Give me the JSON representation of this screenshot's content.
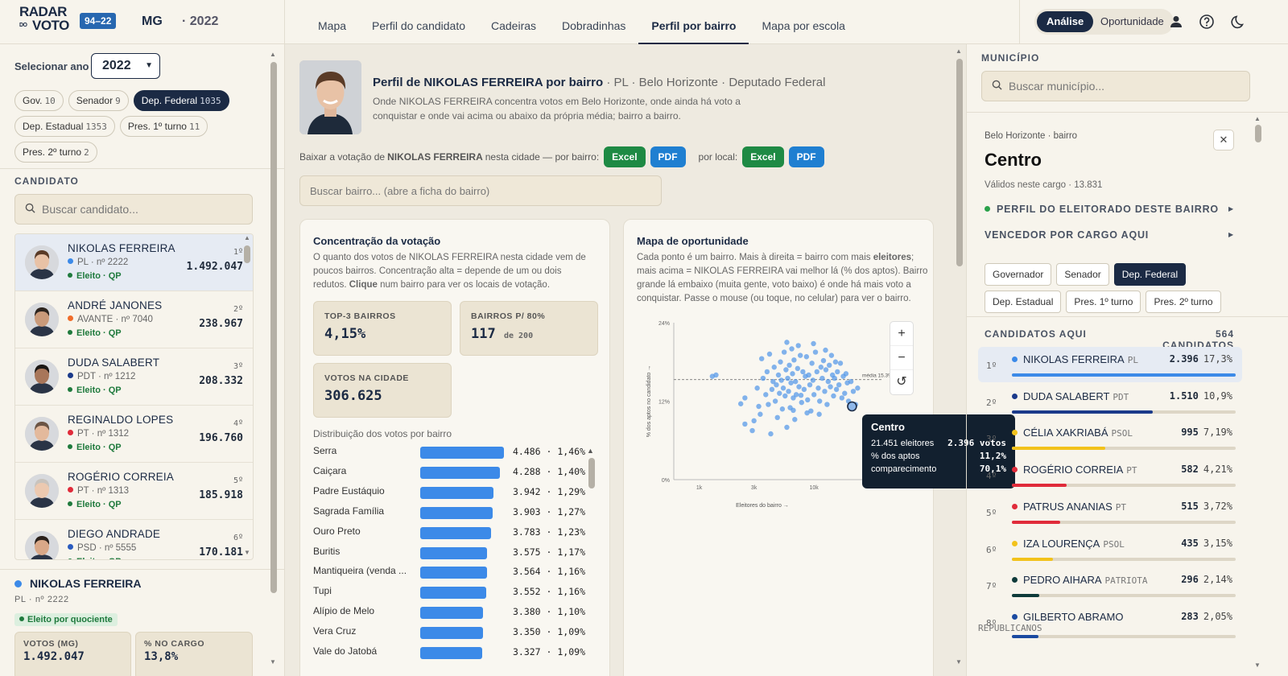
{
  "header": {
    "logo_top": "RADAR",
    "logo_do": "DO",
    "logo_bottom": "VOTO",
    "period_badge": "94–22",
    "state": "MG",
    "year": "· 2022",
    "tabs": [
      "Mapa",
      "Perfil do candidato",
      "Cadeiras",
      "Dobradinhas",
      "Perfil por bairro",
      "Mapa por escola"
    ],
    "mode_active": "Análise",
    "mode_other": "Oportunidade"
  },
  "left": {
    "year_label": "Selecionar ano",
    "year_value": "2022",
    "offices": [
      {
        "label": "Gov.",
        "count": "10",
        "active": false
      },
      {
        "label": "Senador",
        "count": "9",
        "active": false
      },
      {
        "label": "Dep. Federal",
        "count": "1035",
        "active": true
      },
      {
        "label": "Dep. Estadual",
        "count": "1353",
        "active": false
      },
      {
        "label": "Pres. 1º turno",
        "count": "11",
        "active": false
      },
      {
        "label": "Pres. 2º turno",
        "count": "2",
        "active": false
      }
    ],
    "candidate_section": "CANDIDATO",
    "search_placeholder": "Buscar candidato...",
    "candidates": [
      {
        "name": "NIKOLAS FERREIRA",
        "party": "PL · nº 2222",
        "dot": "#3c8ae8",
        "status": "Eleito · QP",
        "rank": "1º",
        "votes": "1.492.047",
        "selected": true
      },
      {
        "name": "ANDRÉ JANONES",
        "party": "AVANTE · nº 7040",
        "dot": "#ef6c2a",
        "status": "Eleito · QP",
        "rank": "2º",
        "votes": "238.967",
        "selected": false
      },
      {
        "name": "DUDA SALABERT",
        "party": "PDT · nº 1212",
        "dot": "#1b3a8a",
        "status": "Eleito · QP",
        "rank": "3º",
        "votes": "208.332",
        "selected": false
      },
      {
        "name": "REGINALDO LOPES",
        "party": "PT · nº 1312",
        "dot": "#e02b3a",
        "status": "Eleito · QP",
        "rank": "4º",
        "votes": "196.760",
        "selected": false
      },
      {
        "name": "ROGÉRIO CORREIA",
        "party": "PT · nº 1313",
        "dot": "#e02b3a",
        "status": "Eleito · QP",
        "rank": "5º",
        "votes": "185.918",
        "selected": false
      },
      {
        "name": "DIEGO ANDRADE",
        "party": "PSD · nº 5555",
        "dot": "#2a5bbf",
        "status": "Eleito · QP",
        "rank": "6º",
        "votes": "170.181",
        "selected": false
      }
    ],
    "summary": {
      "name": "NIKOLAS FERREIRA",
      "dot": "#3c8ae8",
      "party": "PL · nº 2222",
      "status": "Eleito por quociente",
      "votes_label": "VOTOS (MG)",
      "votes": "1.492.047",
      "pct_label": "% NO CARGO",
      "pct": "13,8%"
    }
  },
  "main": {
    "title": "Perfil de NIKOLAS FERREIRA por bairro",
    "title_sub": " · PL · Belo Horizonte · Deputado Federal",
    "desc": "Onde NIKOLAS FERREIRA concentra votos em Belo Horizonte, onde ainda há voto a conquistar e onde vai acima ou abaixo da própria média; bairro a bairro.",
    "dl_pre": "Baixar a votação de ",
    "dl_name": "NIKOLAS FERREIRA",
    "dl_post": " nesta cidade —  por bairro:",
    "dl_local": "por local:",
    "excel": "Excel",
    "pdf": "PDF",
    "search_placeholder": "Buscar bairro... (abre a ficha do bairro)",
    "concentration": {
      "title": "Concentração da votação",
      "desc_a": "O quanto dos votos de NIKOLAS FERREIRA nesta cidade vem de poucos bairros. Concentração alta = depende de um ou dois redutos. ",
      "desc_b": "Clique",
      "desc_c": " num bairro para ver os locais de votação.",
      "top3_label": "TOP-3 BAIRROS",
      "top3": "4,15%",
      "b80_label": "BAIRROS P/ 80%",
      "b80": "117",
      "b80_of": "de 200",
      "votes_label": "VOTOS NA CIDADE",
      "votes": "306.625",
      "dist_label": "Distribuição dos votos por bairro",
      "rows": [
        {
          "name": "Serra",
          "votes": "4.486",
          "pct": "1,46%",
          "v": 4486
        },
        {
          "name": "Caiçara",
          "votes": "4.288",
          "pct": "1,40%",
          "v": 4288
        },
        {
          "name": "Padre Eustáquio",
          "votes": "3.942",
          "pct": "1,29%",
          "v": 3942
        },
        {
          "name": "Sagrada Família",
          "votes": "3.903",
          "pct": "1,27%",
          "v": 3903
        },
        {
          "name": "Ouro Preto",
          "votes": "3.783",
          "pct": "1,23%",
          "v": 3783
        },
        {
          "name": "Buritis",
          "votes": "3.575",
          "pct": "1,17%",
          "v": 3575
        },
        {
          "name": "Mantiqueira (venda ...",
          "votes": "3.564",
          "pct": "1,16%",
          "v": 3564
        },
        {
          "name": "Tupi",
          "votes": "3.552",
          "pct": "1,16%",
          "v": 3552
        },
        {
          "name": "Alípio de Melo",
          "votes": "3.380",
          "pct": "1,10%",
          "v": 3380
        },
        {
          "name": "Vera Cruz",
          "votes": "3.350",
          "pct": "1,09%",
          "v": 3350
        },
        {
          "name": "Vale do Jatobá",
          "votes": "3.327",
          "pct": "1,09%",
          "v": 3327
        }
      ]
    },
    "opportunity": {
      "title": "Mapa de oportunidade",
      "desc_a": "Cada ponto é um bairro. Mais à direita = bairro com mais ",
      "desc_b": "eleitores",
      "desc_c": "; mais acima = NIKOLAS FERREIRA vai melhor lá (% dos aptos). Bairro grande lá embaixo (muita gente, voto baixo) é onde há mais voto a conquistar. Passe o mouse (ou toque, no celular) para ver o bairro.",
      "zoom_in": "+",
      "zoom_out": "−",
      "reset": "↺",
      "tooltip": {
        "name": "Centro",
        "l1": "21.451 eleitores",
        "v1": "2.396 votos",
        "l2": "% dos aptos",
        "v2": "11,2%",
        "l3": "comparecimento",
        "v3": "70,1%"
      }
    }
  },
  "chart_data": {
    "type": "scatter",
    "title": "Mapa de oportunidade",
    "xlabel": "Eleitores do bairro →",
    "ylabel": "% dos aptos no candidato →",
    "x_scale": "log",
    "x_ticks": [
      "1k",
      "3k",
      "10k"
    ],
    "y_ticks": [
      "0%",
      "12%",
      "24%"
    ],
    "xlim": [
      600,
      40000
    ],
    "ylim": [
      0,
      24
    ],
    "mean_label": "média 15.3%",
    "mean": 15.3,
    "highlight": {
      "name": "Centro",
      "x": 21451,
      "y": 11.2
    },
    "points": [
      [
        1300,
        15.8
      ],
      [
        1400,
        16.0
      ],
      [
        2300,
        11.6
      ],
      [
        2500,
        12.5
      ],
      [
        2500,
        8.5
      ],
      [
        2900,
        7.5
      ],
      [
        3000,
        9.0
      ],
      [
        3200,
        14.0
      ],
      [
        3400,
        10.0
      ],
      [
        3500,
        18.5
      ],
      [
        3600,
        15.5
      ],
      [
        3800,
        13.0
      ],
      [
        3900,
        16.5
      ],
      [
        4000,
        11.5
      ],
      [
        4200,
        7.0
      ],
      [
        4300,
        13.8
      ],
      [
        4400,
        15.0
      ],
      [
        4500,
        17.2
      ],
      [
        4600,
        12.0
      ],
      [
        4700,
        14.5
      ],
      [
        4800,
        9.5
      ],
      [
        4900,
        16.0
      ],
      [
        5000,
        13.2
      ],
      [
        5100,
        18.0
      ],
      [
        5200,
        15.2
      ],
      [
        5300,
        10.8
      ],
      [
        5400,
        14.0
      ],
      [
        5500,
        19.5
      ],
      [
        5600,
        12.8
      ],
      [
        5700,
        16.8
      ],
      [
        5800,
        8.0
      ],
      [
        5900,
        15.5
      ],
      [
        6000,
        13.5
      ],
      [
        6100,
        17.5
      ],
      [
        6200,
        11.0
      ],
      [
        6300,
        14.8
      ],
      [
        6400,
        20.0
      ],
      [
        6500,
        16.2
      ],
      [
        6600,
        12.5
      ],
      [
        6700,
        18.3
      ],
      [
        6800,
        9.2
      ],
      [
        6900,
        15.0
      ],
      [
        7000,
        13.0
      ],
      [
        7200,
        17.0
      ],
      [
        7400,
        14.2
      ],
      [
        7600,
        19.0
      ],
      [
        7800,
        11.8
      ],
      [
        8000,
        16.5
      ],
      [
        8200,
        13.8
      ],
      [
        8400,
        15.8
      ],
      [
        8600,
        18.8
      ],
      [
        8800,
        12.2
      ],
      [
        9000,
        16.0
      ],
      [
        9200,
        14.5
      ],
      [
        9400,
        10.5
      ],
      [
        9600,
        17.8
      ],
      [
        9800,
        15.2
      ],
      [
        10000,
        13.0
      ],
      [
        10300,
        19.5
      ],
      [
        10600,
        16.5
      ],
      [
        10900,
        14.0
      ],
      [
        11200,
        12.0
      ],
      [
        11500,
        17.2
      ],
      [
        11800,
        15.5
      ],
      [
        12100,
        18.2
      ],
      [
        12400,
        13.5
      ],
      [
        12700,
        16.8
      ],
      [
        13000,
        11.5
      ],
      [
        13300,
        15.0
      ],
      [
        13600,
        17.5
      ],
      [
        13900,
        14.2
      ],
      [
        14200,
        19.0
      ],
      [
        14500,
        16.0
      ],
      [
        14800,
        12.8
      ],
      [
        15100,
        15.5
      ],
      [
        15400,
        18.0
      ],
      [
        15700,
        13.8
      ],
      [
        16000,
        16.5
      ],
      [
        16500,
        14.5
      ],
      [
        17000,
        17.8
      ],
      [
        17500,
        12.5
      ],
      [
        18000,
        15.8
      ],
      [
        18500,
        13.2
      ],
      [
        19000,
        16.2
      ],
      [
        19500,
        14.8
      ],
      [
        20000,
        12.0
      ],
      [
        21000,
        15.0
      ],
      [
        22000,
        13.5
      ],
      [
        23000,
        11.5
      ],
      [
        24000,
        14.0
      ],
      [
        4100,
        19.2
      ],
      [
        5800,
        21.0
      ],
      [
        7300,
        20.5
      ],
      [
        9900,
        20.8
      ],
      [
        12600,
        19.8
      ],
      [
        8700,
        10.2
      ],
      [
        6600,
        10.6
      ],
      [
        11100,
        10.0
      ],
      [
        3300,
        11.2
      ],
      [
        7700,
        12.9
      ]
    ]
  },
  "right": {
    "muni_label": "MUNICÍPIO",
    "muni_placeholder": "Buscar município...",
    "crumb": "Belo Horizonte · bairro",
    "bairro": "Centro",
    "validos": "Válidos neste cargo · 13.831",
    "perfil": "PERFIL DO ELEITORADO DESTE BAIRRO",
    "vencedor": "VENCEDOR POR CARGO AQUI",
    "cargos": [
      {
        "label": "Governador",
        "active": false
      },
      {
        "label": "Senador",
        "active": false
      },
      {
        "label": "Dep. Federal",
        "active": true
      },
      {
        "label": "Dep. Estadual",
        "active": false
      },
      {
        "label": "Pres. 1º turno",
        "active": false
      },
      {
        "label": "Pres. 2º turno",
        "active": false
      }
    ],
    "cands_label": "CANDIDATOS AQUI",
    "cands_count": "564 CANDIDATOS",
    "cands": [
      {
        "rank": "1º",
        "name": "NIKOLAS FERREIRA",
        "party": "PL",
        "dot": "#3c8ae8",
        "votes": "2.396",
        "pct": "17,3%",
        "p": 17.3,
        "selected": true
      },
      {
        "rank": "2º",
        "name": "DUDA SALABERT",
        "party": "PDT",
        "dot": "#1b3a8a",
        "votes": "1.510",
        "pct": "10,9%",
        "p": 10.9,
        "selected": false
      },
      {
        "rank": "3º",
        "name": "CÉLIA XAKRIABÁ",
        "party": "PSOL",
        "dot": "#f2c21b",
        "votes": "995",
        "pct": "7,19%",
        "p": 7.19,
        "selected": false
      },
      {
        "rank": "4º",
        "name": "ROGÉRIO CORREIA",
        "party": "PT",
        "dot": "#e02b3a",
        "votes": "582",
        "pct": "4,21%",
        "p": 4.21,
        "selected": false
      },
      {
        "rank": "5º",
        "name": "PATRUS ANANIAS",
        "party": "PT",
        "dot": "#e02b3a",
        "votes": "515",
        "pct": "3,72%",
        "p": 3.72,
        "selected": false
      },
      {
        "rank": "6º",
        "name": "IZA LOURENÇA",
        "party": "PSOL",
        "dot": "#f2c21b",
        "votes": "435",
        "pct": "3,15%",
        "p": 3.15,
        "selected": false
      },
      {
        "rank": "7º",
        "name": "PEDRO AIHARA",
        "party": "PATRIOTA",
        "dot": "#0f3b3a",
        "votes": "296",
        "pct": "2,14%",
        "p": 2.14,
        "selected": false
      },
      {
        "rank": "8º",
        "name": "GILBERTO ABRAMO",
        "party": "REPUBLICANOS",
        "dot": "#1b4aa0",
        "votes": "283",
        "pct": "2,05%",
        "p": 2.05,
        "selected": false
      }
    ]
  }
}
